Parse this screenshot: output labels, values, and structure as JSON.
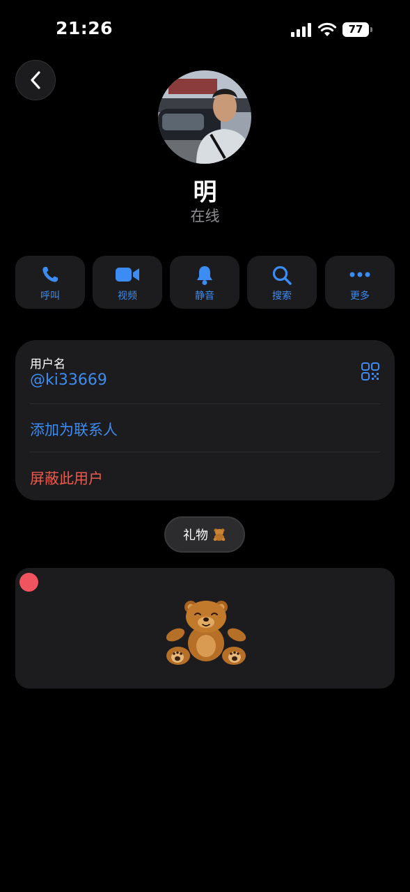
{
  "status_bar": {
    "time": "21:26",
    "battery": "77"
  },
  "profile": {
    "name": "明",
    "status": "在线"
  },
  "actions": [
    {
      "label": "呼叫",
      "icon": "phone-icon"
    },
    {
      "label": "视频",
      "icon": "video-icon"
    },
    {
      "label": "静音",
      "icon": "bell-icon"
    },
    {
      "label": "搜索",
      "icon": "search-icon"
    },
    {
      "label": "更多",
      "icon": "more-icon"
    }
  ],
  "info": {
    "username_label": "用户名",
    "username_value": "@ki33669",
    "add_contact": "添加为联系人",
    "block_user": "屏蔽此用户"
  },
  "gifts": {
    "label": "礼物"
  },
  "colors": {
    "accent": "#3d8cf4",
    "danger": "#ea5a4e",
    "card": "#1c1c1e",
    "background": "#000000"
  }
}
